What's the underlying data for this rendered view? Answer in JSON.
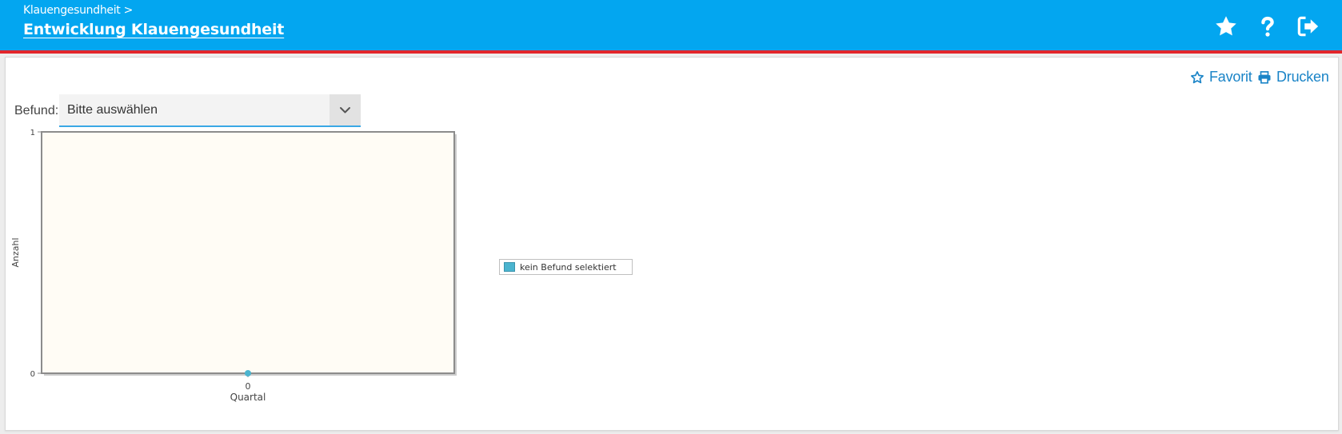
{
  "header": {
    "breadcrumb": "Klauengesundheit >",
    "title": "Entwicklung Klauengesundheit",
    "icons": [
      "star-icon",
      "help-icon",
      "logout-icon"
    ]
  },
  "actions": {
    "favorit_label": "Favorit",
    "drucken_label": "Drucken"
  },
  "filter": {
    "label": "Befund:",
    "selected": "Bitte auswählen"
  },
  "chart_data": {
    "type": "line",
    "x": [
      0
    ],
    "series": [
      {
        "name": "kein Befund selektiert",
        "values": [
          0
        ]
      }
    ],
    "xlabel": "Quartal",
    "ylabel": "Anzahl",
    "x_ticks": [
      "0"
    ],
    "y_ticks": [
      "0",
      "1"
    ],
    "ylim": [
      0,
      1
    ],
    "legend_position": "right",
    "colors": {
      "series": "#4bb4cf",
      "plot_background": "#fffcf5"
    }
  },
  "colors": {
    "header": "#03a6f0",
    "header_border": "#e2262b",
    "link": "#1a84c7"
  }
}
